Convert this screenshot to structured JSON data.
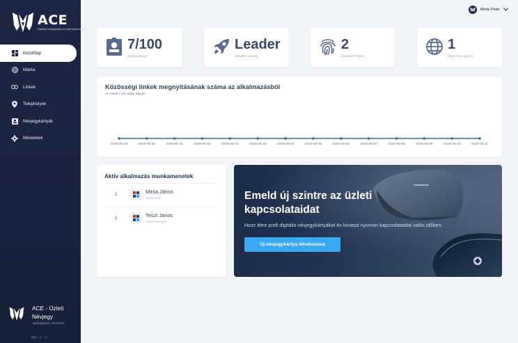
{
  "app": {
    "logo_text": "ACE",
    "logo_tagline": "Digitális névjegykártya és üzleti kapcsolatok",
    "brand_name": "ACE - Üzleti Névjegy",
    "brand_sub": "Ajánlatkérés: XXXXXX",
    "version": "BM · 2 · 3"
  },
  "sidebar": {
    "items": [
      {
        "label": "Kezdőlap",
        "icon": "dashboard-icon",
        "active": true
      },
      {
        "label": "Márka",
        "icon": "palette-icon",
        "active": false
      },
      {
        "label": "Linkek",
        "icon": "link-icon",
        "active": false
      },
      {
        "label": "Telephelyek",
        "icon": "map-pin-icon",
        "active": false
      },
      {
        "label": "Névjegykártyák",
        "icon": "contact-card-icon",
        "active": false
      },
      {
        "label": "Műveletek",
        "icon": "gear-icon",
        "active": false
      }
    ]
  },
  "header": {
    "user_name": "Minta Péter",
    "dropdown_icon": "chevron-down-icon"
  },
  "stats": [
    {
      "value": "7/100",
      "label": "névjegykártya",
      "icon": "contact-card-icon"
    },
    {
      "value": "Leader",
      "label": "aktuális csomag",
      "icon": "rocket-icon"
    },
    {
      "value": "2",
      "label": "elmentett márka",
      "icon": "fingerprint-icon"
    },
    {
      "value": "1",
      "label": "https://ace-app.hu",
      "icon": "globe-icon"
    }
  ],
  "chart": {
    "title": "Közösségi linkek megnyitásának száma az alkalmazásból",
    "subtitle": "Az elmúlt 2 hét adatai alapján"
  },
  "chart_data": {
    "type": "line",
    "x": [
      "2026-05-29",
      "2026-05-30",
      "2026-05-31",
      "2026-06-01",
      "2026-06-02",
      "2026-06-03",
      "2026-06-04",
      "2026-06-05",
      "2026-06-06",
      "2026-06-07",
      "2026-06-08",
      "2026-06-09",
      "2026-06-10",
      "2026-06-11"
    ],
    "series": [
      {
        "values": [
          0,
          0,
          0,
          0,
          0,
          0,
          0,
          0,
          0,
          0,
          0,
          0,
          0,
          0
        ]
      }
    ],
    "line_color": "#2f6e8a",
    "grid": false
  },
  "sessions": {
    "title": "Aktív alkalmazás munkamenetek",
    "items": [
      {
        "num": "1.",
        "name": "Minta János",
        "role": "Ügyvezető"
      },
      {
        "num": "2.",
        "name": "Teszt János",
        "role": "Sales Manager"
      }
    ]
  },
  "promo": {
    "title": "Emeld új szintre az üzleti kapcsolataidat",
    "description": "Hozz létre profi digitális névjegykártyákat és kövesd nyomon kapcsolataidat valós időben.",
    "button_label": "Új névjegykártya létrehozása"
  },
  "colors": {
    "sidebar_bg": "#1d2544",
    "accent": "#3aa9f4",
    "stat_icon": "#5a6a8c",
    "chart_line": "#2f6e8a"
  }
}
